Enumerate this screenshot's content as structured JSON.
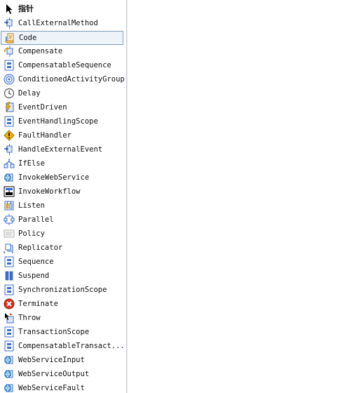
{
  "toolbox": {
    "items": [
      {
        "label": "指针",
        "icon": "pointer-icon",
        "selected": false
      },
      {
        "label": "CallExternalMethod",
        "icon": "call-external-method-icon",
        "selected": false
      },
      {
        "label": "Code",
        "icon": "code-icon",
        "selected": true
      },
      {
        "label": "Compensate",
        "icon": "compensate-icon",
        "selected": false
      },
      {
        "label": "CompensatableSequence",
        "icon": "compensatable-sequence-icon",
        "selected": false
      },
      {
        "label": "ConditionedActivityGroup",
        "icon": "conditioned-activity-group-icon",
        "selected": false
      },
      {
        "label": "Delay",
        "icon": "delay-clock-icon",
        "selected": false
      },
      {
        "label": "EventDriven",
        "icon": "event-driven-icon",
        "selected": false
      },
      {
        "label": "EventHandlingScope",
        "icon": "event-handling-scope-icon",
        "selected": false
      },
      {
        "label": "FaultHandler",
        "icon": "fault-handler-icon",
        "selected": false
      },
      {
        "label": "HandleExternalEvent",
        "icon": "handle-external-event-icon",
        "selected": false
      },
      {
        "label": "IfElse",
        "icon": "if-else-icon",
        "selected": false
      },
      {
        "label": "InvokeWebService",
        "icon": "invoke-web-service-icon",
        "selected": false
      },
      {
        "label": "InvokeWorkflow",
        "icon": "invoke-workflow-icon",
        "selected": false
      },
      {
        "label": "Listen",
        "icon": "listen-icon",
        "selected": false
      },
      {
        "label": "Parallel",
        "icon": "parallel-icon",
        "selected": false
      },
      {
        "label": "Policy",
        "icon": "policy-icon",
        "selected": false
      },
      {
        "label": "Replicator",
        "icon": "replicator-icon",
        "selected": false
      },
      {
        "label": "Sequence",
        "icon": "sequence-icon",
        "selected": false
      },
      {
        "label": "Suspend",
        "icon": "suspend-icon",
        "selected": false
      },
      {
        "label": "SynchronizationScope",
        "icon": "synchronization-scope-icon",
        "selected": false
      },
      {
        "label": "Terminate",
        "icon": "terminate-icon",
        "selected": false
      },
      {
        "label": "Throw",
        "icon": "throw-icon",
        "selected": false
      },
      {
        "label": "TransactionScope",
        "icon": "transaction-scope-icon",
        "selected": false
      },
      {
        "label": "CompensatableTransact...",
        "icon": "compensatable-transaction-scope-icon",
        "selected": false
      },
      {
        "label": "WebServiceInput",
        "icon": "web-service-input-icon",
        "selected": false
      },
      {
        "label": "WebServiceOutput",
        "icon": "web-service-output-icon",
        "selected": false
      },
      {
        "label": "WebServiceFault",
        "icon": "web-service-fault-icon",
        "selected": false
      }
    ]
  },
  "colors": {
    "selection_border": "#7f9db9",
    "selection_fill": "#eef3fa",
    "icon_blue": "#3a6fd0",
    "terminate_red": "#d4331c",
    "fault_yellow": "#f2b200"
  }
}
